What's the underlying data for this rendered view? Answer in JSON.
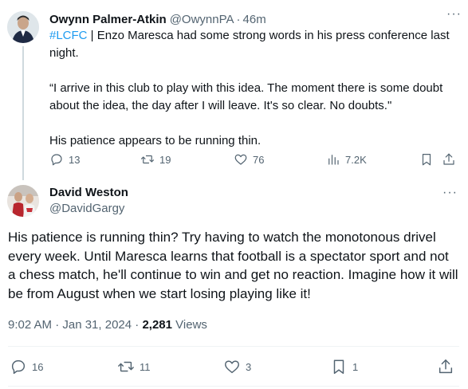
{
  "parent_tweet": {
    "author_name": "Owynn Palmer-Atkin",
    "handle": "@OwynnPA",
    "separator": "·",
    "time_ago": "46m",
    "more_label": "···",
    "hashtag": "#LCFC",
    "line1_rest": " | Enzo Maresca had some strong words in his press conference last night.",
    "quote": "“I arrive in this club to play with this idea. The moment there is some doubt about the idea, the day after I will leave. It's so clear. No doubts.\"",
    "closing": "His patience appears to be running thin.",
    "stats": {
      "replies": "13",
      "reposts": "19",
      "likes": "76",
      "views": "7.2K"
    },
    "icons": [
      "reply-icon",
      "repost-icon",
      "like-icon",
      "views-icon",
      "bookmark-icon",
      "share-icon"
    ]
  },
  "reply_tweet": {
    "author_name": "David Weston",
    "handle": "@DavidGargy",
    "more_label": "···",
    "text": "His patience is running thin? Try having to watch the monotonous drivel every week. Until Maresca learns that football is a spectator sport and not a chess match, he'll continue to win and get no reaction.  Imagine how it will be from August when we start losing playing like it!",
    "timestamp": "9:02 AM · Jan 31, 2024",
    "meta_separator": " · ",
    "views_count": "2,281",
    "views_label": " Views",
    "stats": {
      "replies": "16",
      "reposts": "11",
      "likes": "3",
      "bookmarks": "1"
    },
    "icons": [
      "reply-icon",
      "repost-icon",
      "like-icon",
      "bookmark-icon",
      "share-icon"
    ]
  },
  "colors": {
    "text_primary": "#0f1419",
    "text_secondary": "#536471",
    "link": "#1d9bf0",
    "divider": "#eff3f4",
    "thread_line": "#cfd9de"
  }
}
